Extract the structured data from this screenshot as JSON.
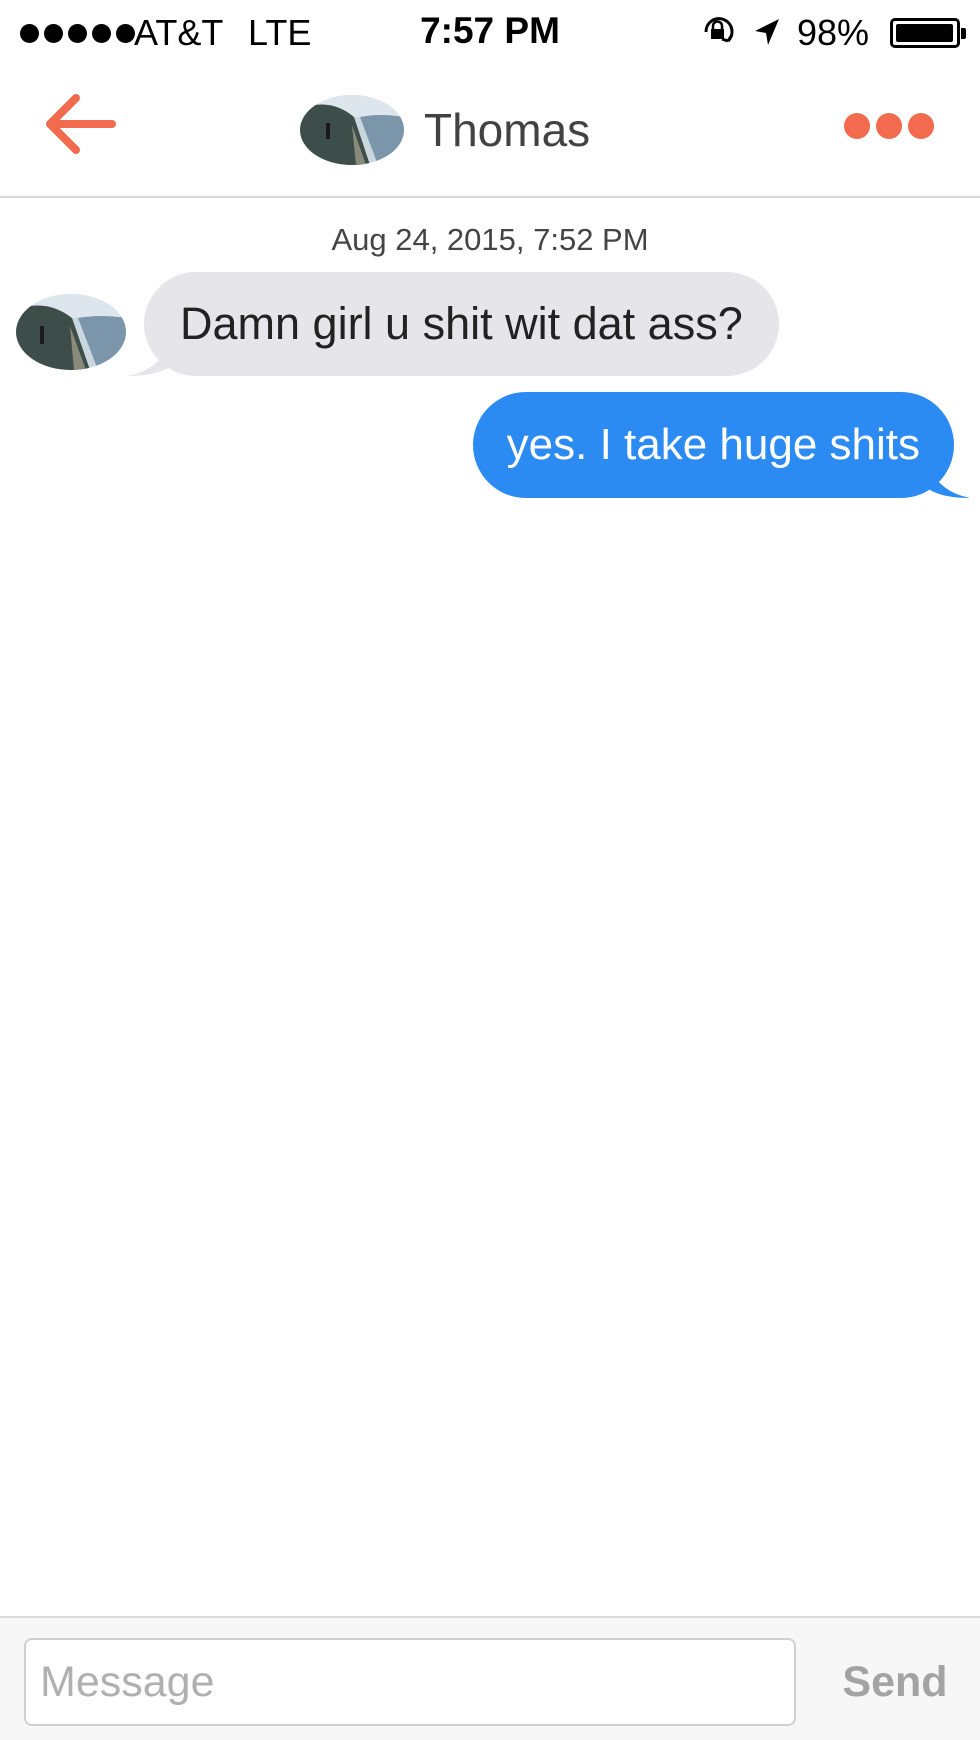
{
  "status_bar": {
    "carrier": "AT&T",
    "network": "LTE",
    "time": "7:57 PM",
    "battery_percent": "98%",
    "battery_level": 0.98,
    "icons": [
      "signal-dots",
      "orientation-lock-icon",
      "location-arrow-icon",
      "battery-icon"
    ]
  },
  "header": {
    "contact_name": "Thomas",
    "back_icon": "arrow-left-icon",
    "more_icon": "more-dots-icon",
    "accent_color": "#f26b4e"
  },
  "thread": {
    "timestamp": "Aug 24, 2015, 7:52 PM",
    "messages": [
      {
        "direction": "incoming",
        "text": "Damn girl u shit wit dat ass?"
      },
      {
        "direction": "outgoing",
        "text": "yes. I take huge shits"
      }
    ],
    "incoming_bubble_color": "#e6e5ea",
    "outgoing_bubble_color": "#2c8bf2"
  },
  "composer": {
    "placeholder": "Message",
    "value": "",
    "send_label": "Send"
  }
}
